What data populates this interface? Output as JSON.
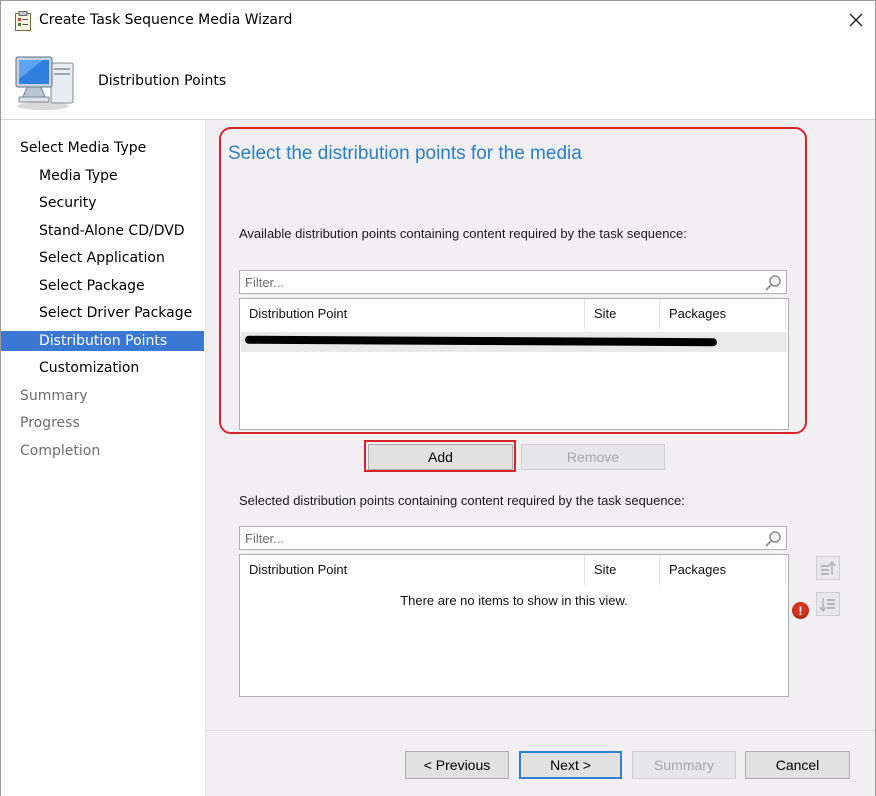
{
  "window": {
    "title": "Create Task Sequence Media Wizard"
  },
  "header": {
    "title": "Distribution Points"
  },
  "nav": {
    "items": [
      {
        "label": "Select Media Type",
        "level": 0,
        "state": "normal"
      },
      {
        "label": "Media Type",
        "level": 1,
        "state": "normal"
      },
      {
        "label": "Security",
        "level": 1,
        "state": "normal"
      },
      {
        "label": "Stand-Alone CD/DVD",
        "level": 1,
        "state": "normal"
      },
      {
        "label": "Select Application",
        "level": 1,
        "state": "normal"
      },
      {
        "label": "Select Package",
        "level": 1,
        "state": "normal"
      },
      {
        "label": "Select Driver Package",
        "level": 1,
        "state": "normal"
      },
      {
        "label": "Distribution Points",
        "level": 1,
        "state": "active"
      },
      {
        "label": "Customization",
        "level": 1,
        "state": "normal"
      },
      {
        "label": "Summary",
        "level": 0,
        "state": "disabled"
      },
      {
        "label": "Progress",
        "level": 0,
        "state": "disabled"
      },
      {
        "label": "Completion",
        "level": 0,
        "state": "disabled"
      }
    ]
  },
  "main": {
    "heading": "Select the distribution points for the media",
    "available": {
      "label": "Available distribution points containing content required by the task sequence:",
      "filter_placeholder": "Filter...",
      "columns": [
        "Distribution Point",
        "Site",
        "Packages"
      ],
      "rows": [
        {
          "redacted": true
        }
      ]
    },
    "add_label": "Add",
    "remove_label": "Remove",
    "selected": {
      "label": "Selected distribution points containing content required by the task sequence:",
      "filter_placeholder": "Filter...",
      "columns": [
        "Distribution Point",
        "Site",
        "Packages"
      ],
      "empty_message": "There are no items to show in this view."
    }
  },
  "footer": {
    "previous_label": "< Previous",
    "next_label": "Next >",
    "summary_label": "Summary",
    "cancel_label": "Cancel"
  },
  "colors": {
    "heading": "#2a7fc6",
    "nav_active": "#3a78d4",
    "highlight": "#d8232a",
    "error": "#d9341f"
  }
}
